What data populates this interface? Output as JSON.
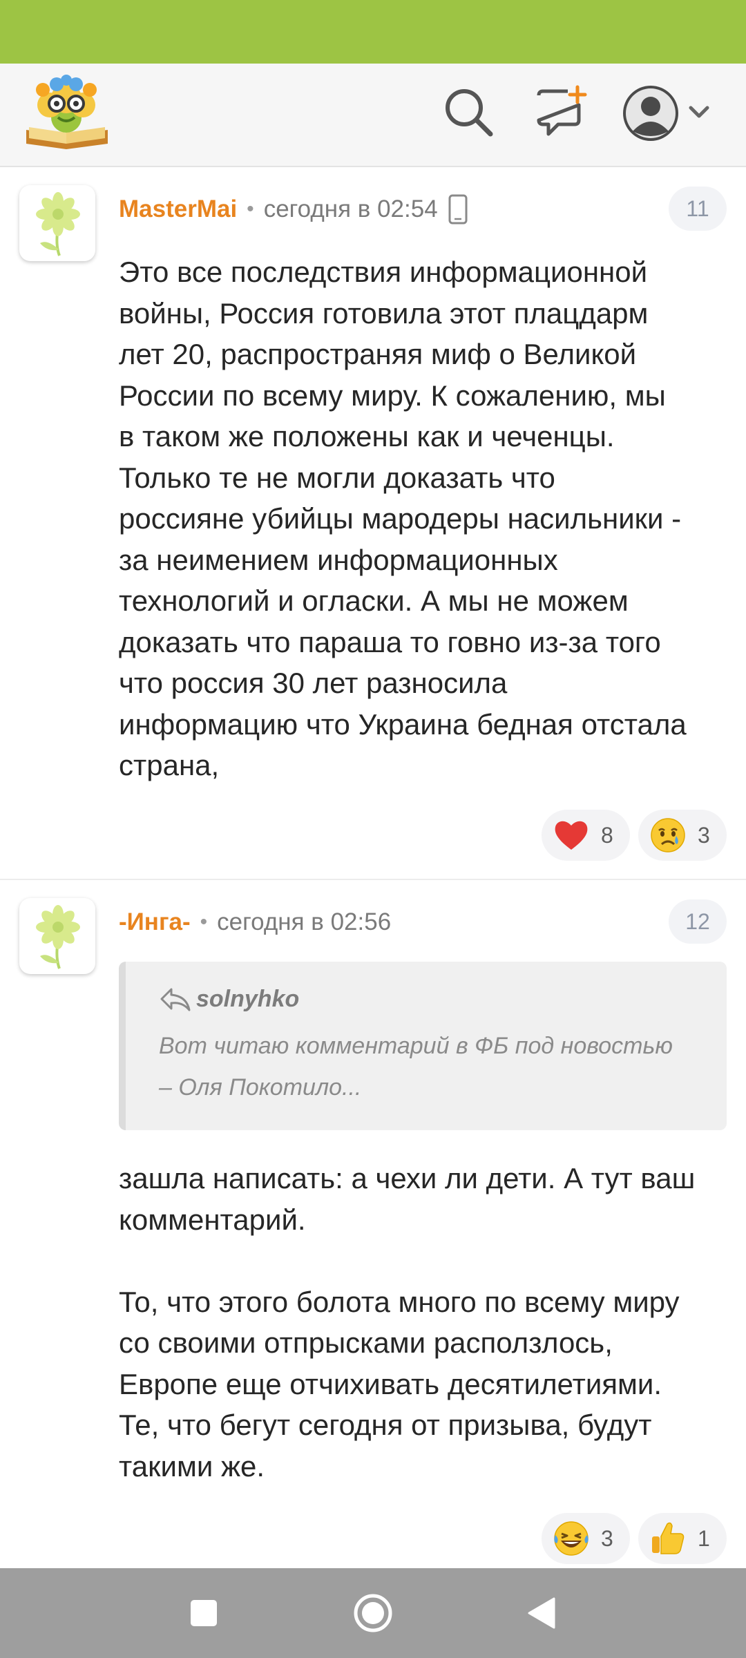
{
  "colors": {
    "status_bar": "#9dc444",
    "author": "#e8841f",
    "nav_bar": "#9e9e9e"
  },
  "header": {
    "logo_icon": "book-reader-mascot-icon",
    "icons": [
      "search-icon",
      "new-message-icon",
      "profile-avatar-icon",
      "chevron-down-icon"
    ]
  },
  "comments": [
    {
      "author": "MasterMai",
      "separator": "•",
      "time": "сегодня в 02:54",
      "device_icon": "mobile-device-icon",
      "number": "11",
      "text": "Это все последствия информационной\nвойны, Россия готовила этот плацдарм\nлет 20, распространяя миф о Великой\nРоссии по всему миру. К сожалению, мы\nв таком же положены как и чеченцы.\nТолько те не могли доказать что\nроссияне убийцы мародеры насильники -\nза неимением информационных\nтехнологий и огласки. А мы не можем\nдоказать что параша то говно из-за того\nчто россия 30 лет разносила\nинформацию что Украина бедная отстала\nстрана,",
      "reactions": [
        {
          "icon": "heart-icon",
          "count": "8"
        },
        {
          "icon": "crying-face-icon",
          "count": "3"
        }
      ]
    },
    {
      "author": "-Инга-",
      "separator": "•",
      "time": "сегодня в 02:56",
      "number": "12",
      "quote": {
        "author": "solnyhko",
        "text": "Вот читаю комментарий в ФБ под новостью\n– Оля Покотило..."
      },
      "text": "зашла написать: а чехи ли дети. А тут ваш\nкомментарий.\n\nТо, что этого болота много по всему миру\nсо своими отпрысками расползлось,\nЕвропе еще отчихивать десятилетиями.\nТе, что бегут сегодня от призыва, будут\nтакими же.",
      "reactions": [
        {
          "icon": "laughing-tears-icon",
          "count": "3"
        },
        {
          "icon": "thumbs-up-icon",
          "count": "1"
        }
      ]
    }
  ],
  "nav": {
    "icons": [
      "recent-apps-icon",
      "home-icon",
      "back-icon"
    ]
  }
}
